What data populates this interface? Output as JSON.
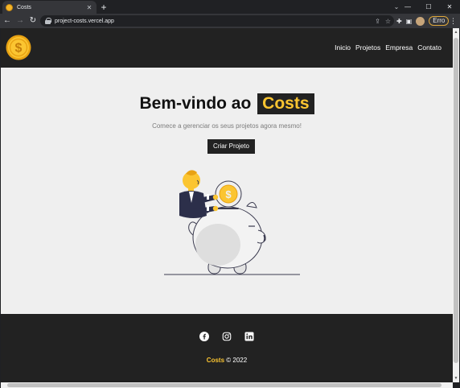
{
  "browser": {
    "tab_title": "Costs",
    "tab_close": "✕",
    "new_tab": "+",
    "url": "project-costs.vercel.app",
    "error_label": "Erro",
    "window_controls": [
      "—",
      "☐",
      "✕"
    ],
    "tabsearch": "⌄"
  },
  "nav": {
    "links": [
      "Inicio",
      "Projetos",
      "Empresa",
      "Contato"
    ]
  },
  "hero": {
    "title_prefix": "Bem-vindo ao",
    "title_brand": "Costs",
    "subtitle": "Comece a gerenciar os seus projetos agora mesmo!",
    "cta_label": "Criar Projeto"
  },
  "footer": {
    "social_icons": [
      "facebook-icon",
      "instagram-icon",
      "linkedin-icon"
    ],
    "brand": "Costs",
    "copyright_suffix": "© 2022"
  },
  "colors": {
    "accent": "#fbc531",
    "dark": "#222222",
    "page_bg": "#efefef"
  }
}
